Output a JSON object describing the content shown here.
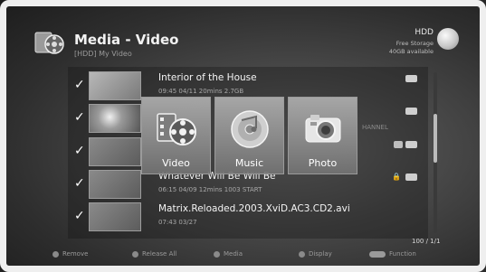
{
  "header": {
    "title": "Media - Video",
    "subtitle": "[HDD] My Video",
    "icon": "film-folder-icon"
  },
  "storage": {
    "label": "HDD",
    "line1": "Free Storage",
    "line2": "40GB available",
    "icon": "disk-icon"
  },
  "list": [
    {
      "title": "Interior of the House",
      "meta": "09:45 04/11 20mins 2.7GB",
      "checked": true
    },
    {
      "title": "",
      "meta": "",
      "checked": true,
      "extra": "HANNEL"
    },
    {
      "title": "",
      "meta": "",
      "checked": true
    },
    {
      "title": "Whatever Will Be Will Be",
      "meta": "06:15 04/09 12mins 1003 START",
      "checked": true
    },
    {
      "title": "Matrix.Reloaded.2003.XviD.AC3.CD2.avi",
      "meta": "07:43 03/27",
      "checked": true
    }
  ],
  "categories": [
    {
      "label": "Video",
      "icon": "film-reel-icon"
    },
    {
      "label": "Music",
      "icon": "music-disc-icon"
    },
    {
      "label": "Photo",
      "icon": "camera-icon"
    }
  ],
  "footer": {
    "buttons": [
      {
        "label": "Remove",
        "key": "red"
      },
      {
        "label": "Release All",
        "key": "green"
      },
      {
        "label": "Media",
        "key": "yellow"
      },
      {
        "label": "Display",
        "key": "blue"
      },
      {
        "label": "Function",
        "key": "opt"
      }
    ],
    "pager": "100 / 1/1"
  },
  "colors": {
    "background": "#4a4a4a",
    "frame": "#efefef",
    "text": "#f2f2f2",
    "muted": "#9a9a9a"
  }
}
